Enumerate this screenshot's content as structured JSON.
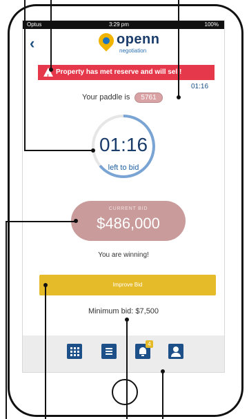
{
  "status_bar": {
    "carrier": "Optus",
    "time": "3:29 pm",
    "battery": "100%"
  },
  "header": {
    "back_icon": "chevron-left-icon",
    "logo_main": "openn",
    "logo_sub": "negotiation"
  },
  "banner": {
    "text": "Property has met reserve and will sell!",
    "icon": "warning-icon",
    "color": "#e5394b"
  },
  "timer_small": "01:16",
  "paddle": {
    "label": "Your paddle is",
    "number": "5761"
  },
  "countdown": {
    "time": "01:16",
    "label": "left to bid"
  },
  "current_bid": {
    "label": "CURRENT BID",
    "amount": "$486,000"
  },
  "status_message": "You are winning!",
  "improve_bid_label": "Improve Bid",
  "minimum_bid": "Minimum bid: $7,500",
  "nav": {
    "items": [
      {
        "icon": "grid-icon"
      },
      {
        "icon": "list-icon"
      },
      {
        "icon": "bell-icon",
        "badge": "4"
      },
      {
        "icon": "user-icon"
      }
    ]
  },
  "colors": {
    "primary": "#1d4f88",
    "accent": "#e5bb2a",
    "bid_pill": "#c99b9b",
    "ring": "#7aa4d4"
  }
}
